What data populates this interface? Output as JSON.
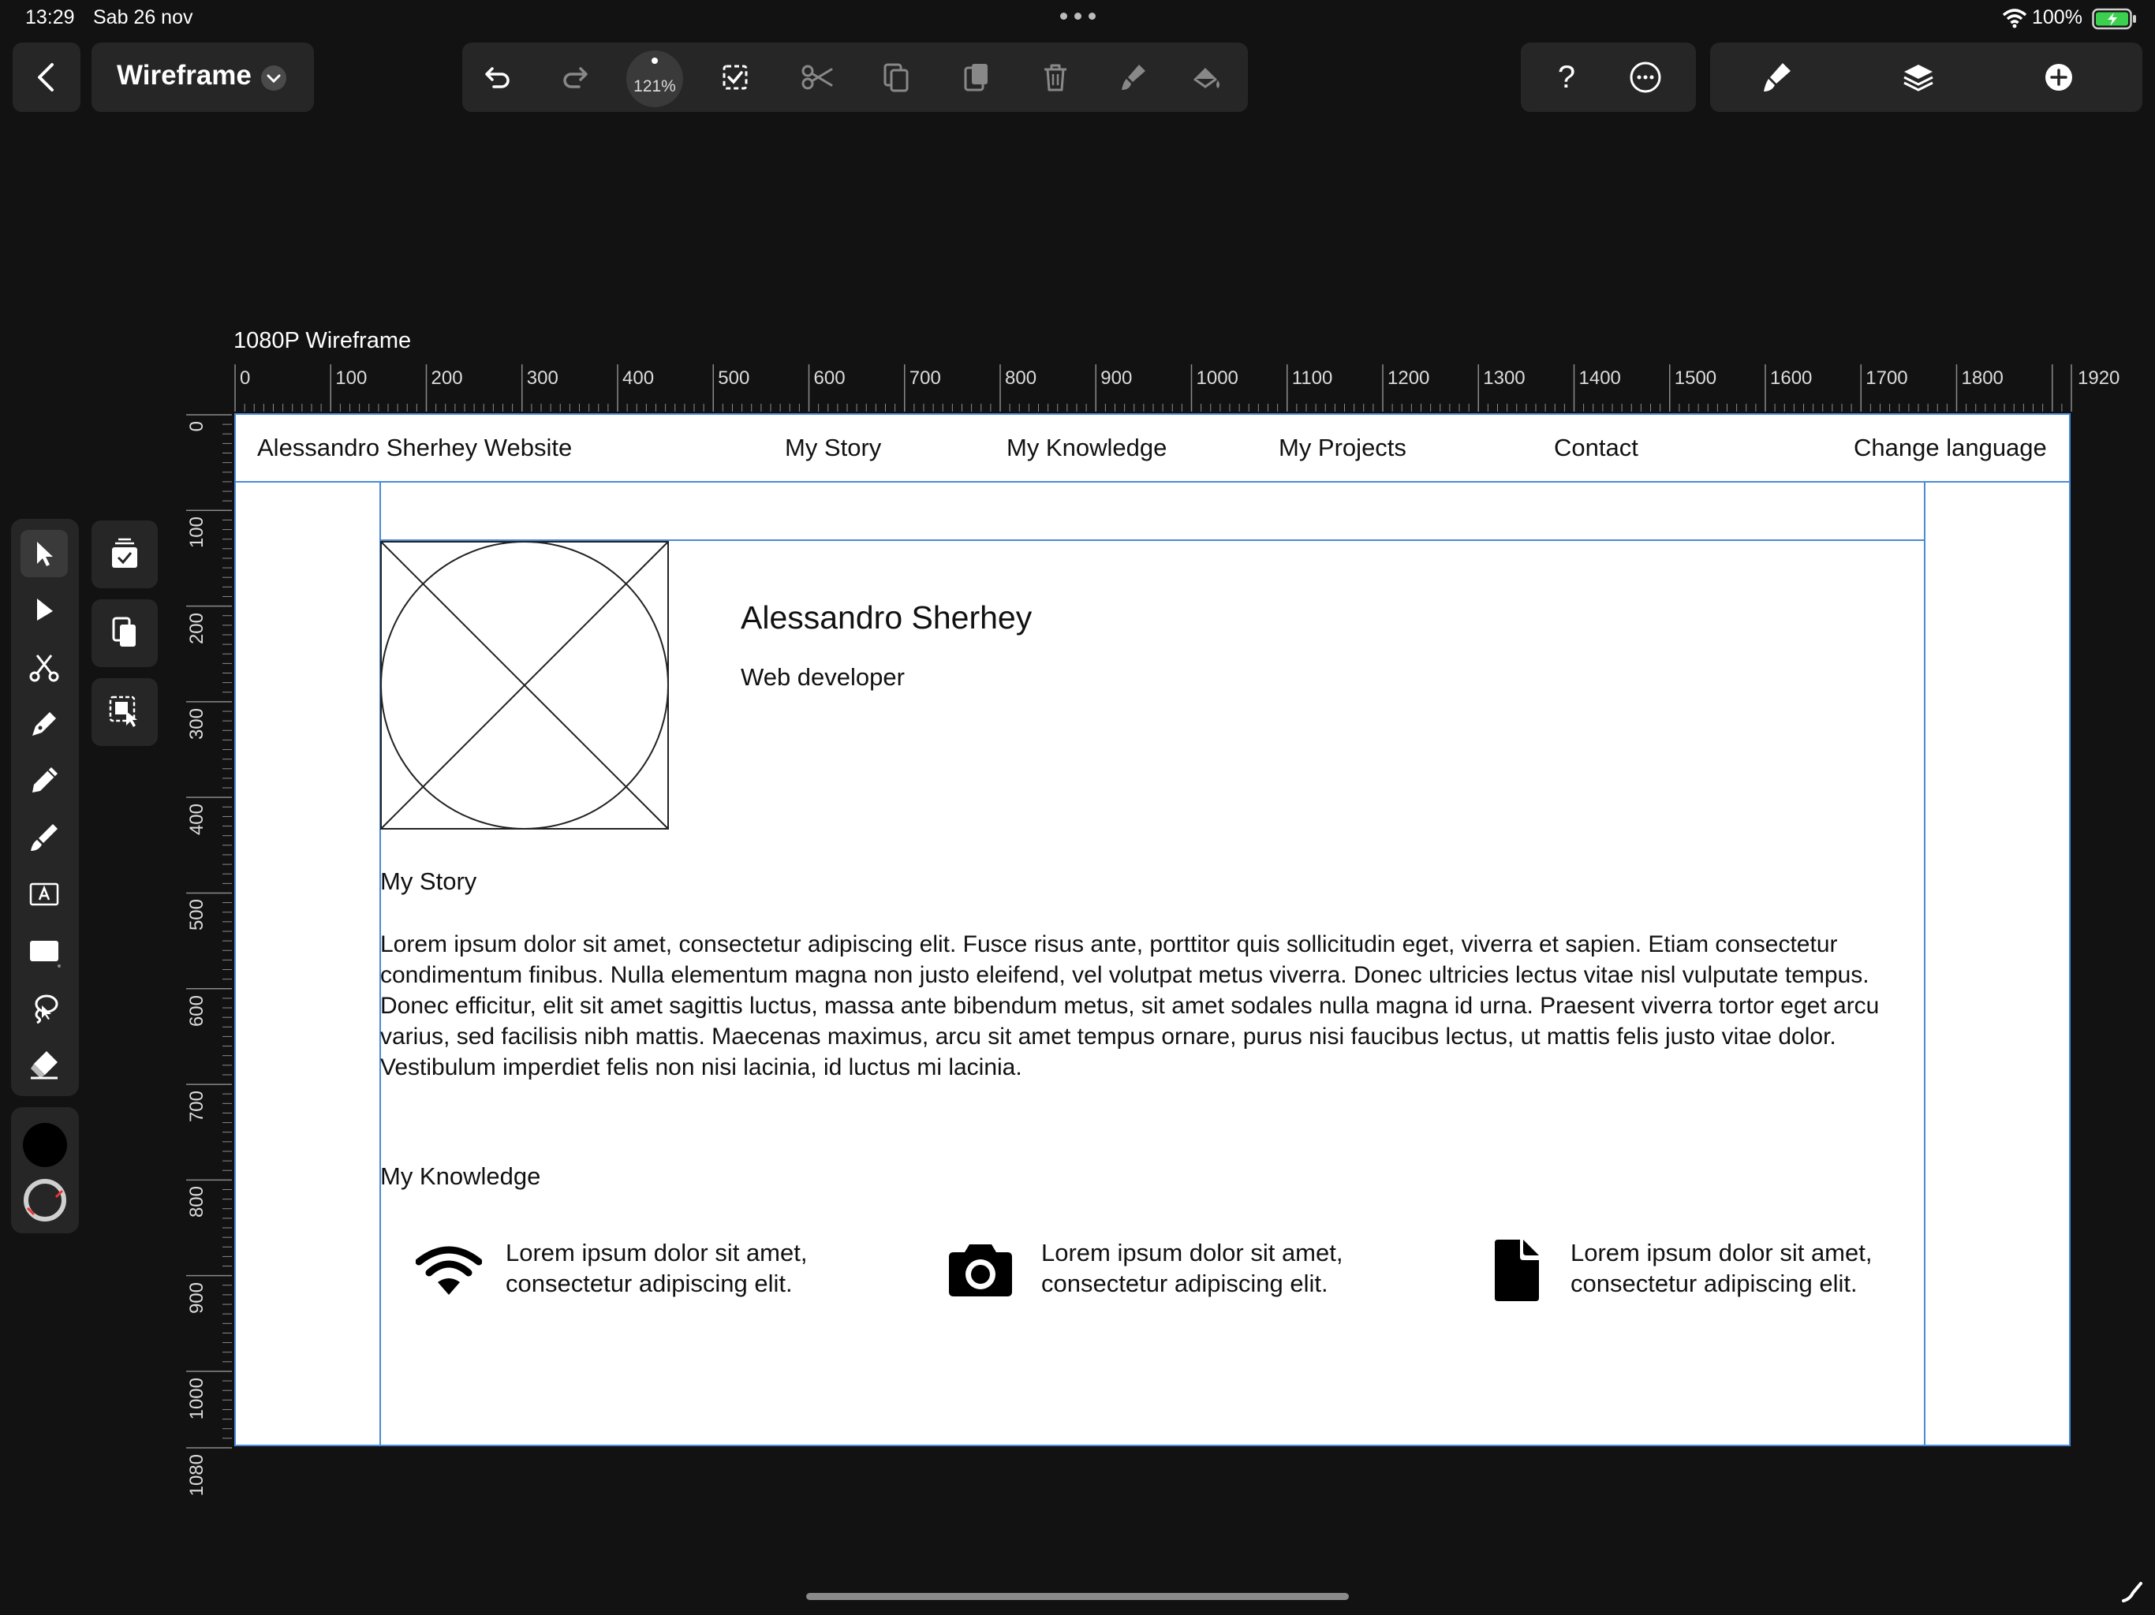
{
  "status_bar": {
    "time": "13:29",
    "date": "Sab 26 nov",
    "battery": "100%"
  },
  "header": {
    "back_icon": "chevron-left-icon",
    "doc_title": "Wireframe"
  },
  "toolbar": {
    "zoom": "121%",
    "help": "?"
  },
  "canvas": {
    "artboard_title": "1080P Wireframe"
  },
  "ruler": {
    "h_labels": [
      "0",
      "100",
      "200",
      "300",
      "400",
      "500",
      "600",
      "700",
      "800",
      "900",
      "1000",
      "1100",
      "1200",
      "1300",
      "1400",
      "1500",
      "1600",
      "1700",
      "1800",
      "1920"
    ],
    "v_labels": [
      "0",
      "100",
      "200",
      "300",
      "400",
      "500",
      "600",
      "700",
      "800",
      "900",
      "1000",
      "1080"
    ]
  },
  "wireframe": {
    "site_title": "Alessandro Sherhey Website",
    "nav": [
      "My Story",
      "My Knowledge",
      "My Projects",
      "Contact",
      "Change language"
    ],
    "profile_name": "Alessandro Sherhey",
    "profile_role": "Web developer",
    "story_heading": "My Story",
    "story_text": "Lorem ipsum dolor sit amet, consectetur adipiscing elit. Fusce risus ante, porttitor quis sollicitudin eget, viverra et sapien. Etiam consectetur condimentum finibus. Nulla elementum magna non justo eleifend, vel volutpat metus viverra. Donec ultricies lectus vitae nisl vulputate tempus. Donec efficitur, elit sit amet sagittis luctus, massa ante bibendum metus, sit amet sodales nulla magna id urna. Praesent viverra tortor eget arcu varius, sed facilisis nibh mattis. Maecenas maximus, arcu sit amet tempus ornare, purus nisi faucibus lectus, ut mattis felis justo vitae dolor. Vestibulum imperdiet felis non nisi lacinia, id luctus mi lacinia.",
    "knowledge_heading": "My Knowledge",
    "knowledge_items": [
      {
        "icon": "wifi-icon",
        "line1": "Lorem ipsum dolor sit amet,",
        "line2": "consectetur adipiscing elit."
      },
      {
        "icon": "camera-icon",
        "line1": "Lorem ipsum dolor sit amet,",
        "line2": "consectetur adipiscing elit."
      },
      {
        "icon": "document-icon",
        "line1": "Lorem ipsum dolor sit amet,",
        "line2": "consectetur adipiscing elit."
      }
    ]
  },
  "colors": {
    "background": "#121212",
    "panel": "#262626",
    "guide": "#4a8ad8",
    "wire": "#111111"
  }
}
